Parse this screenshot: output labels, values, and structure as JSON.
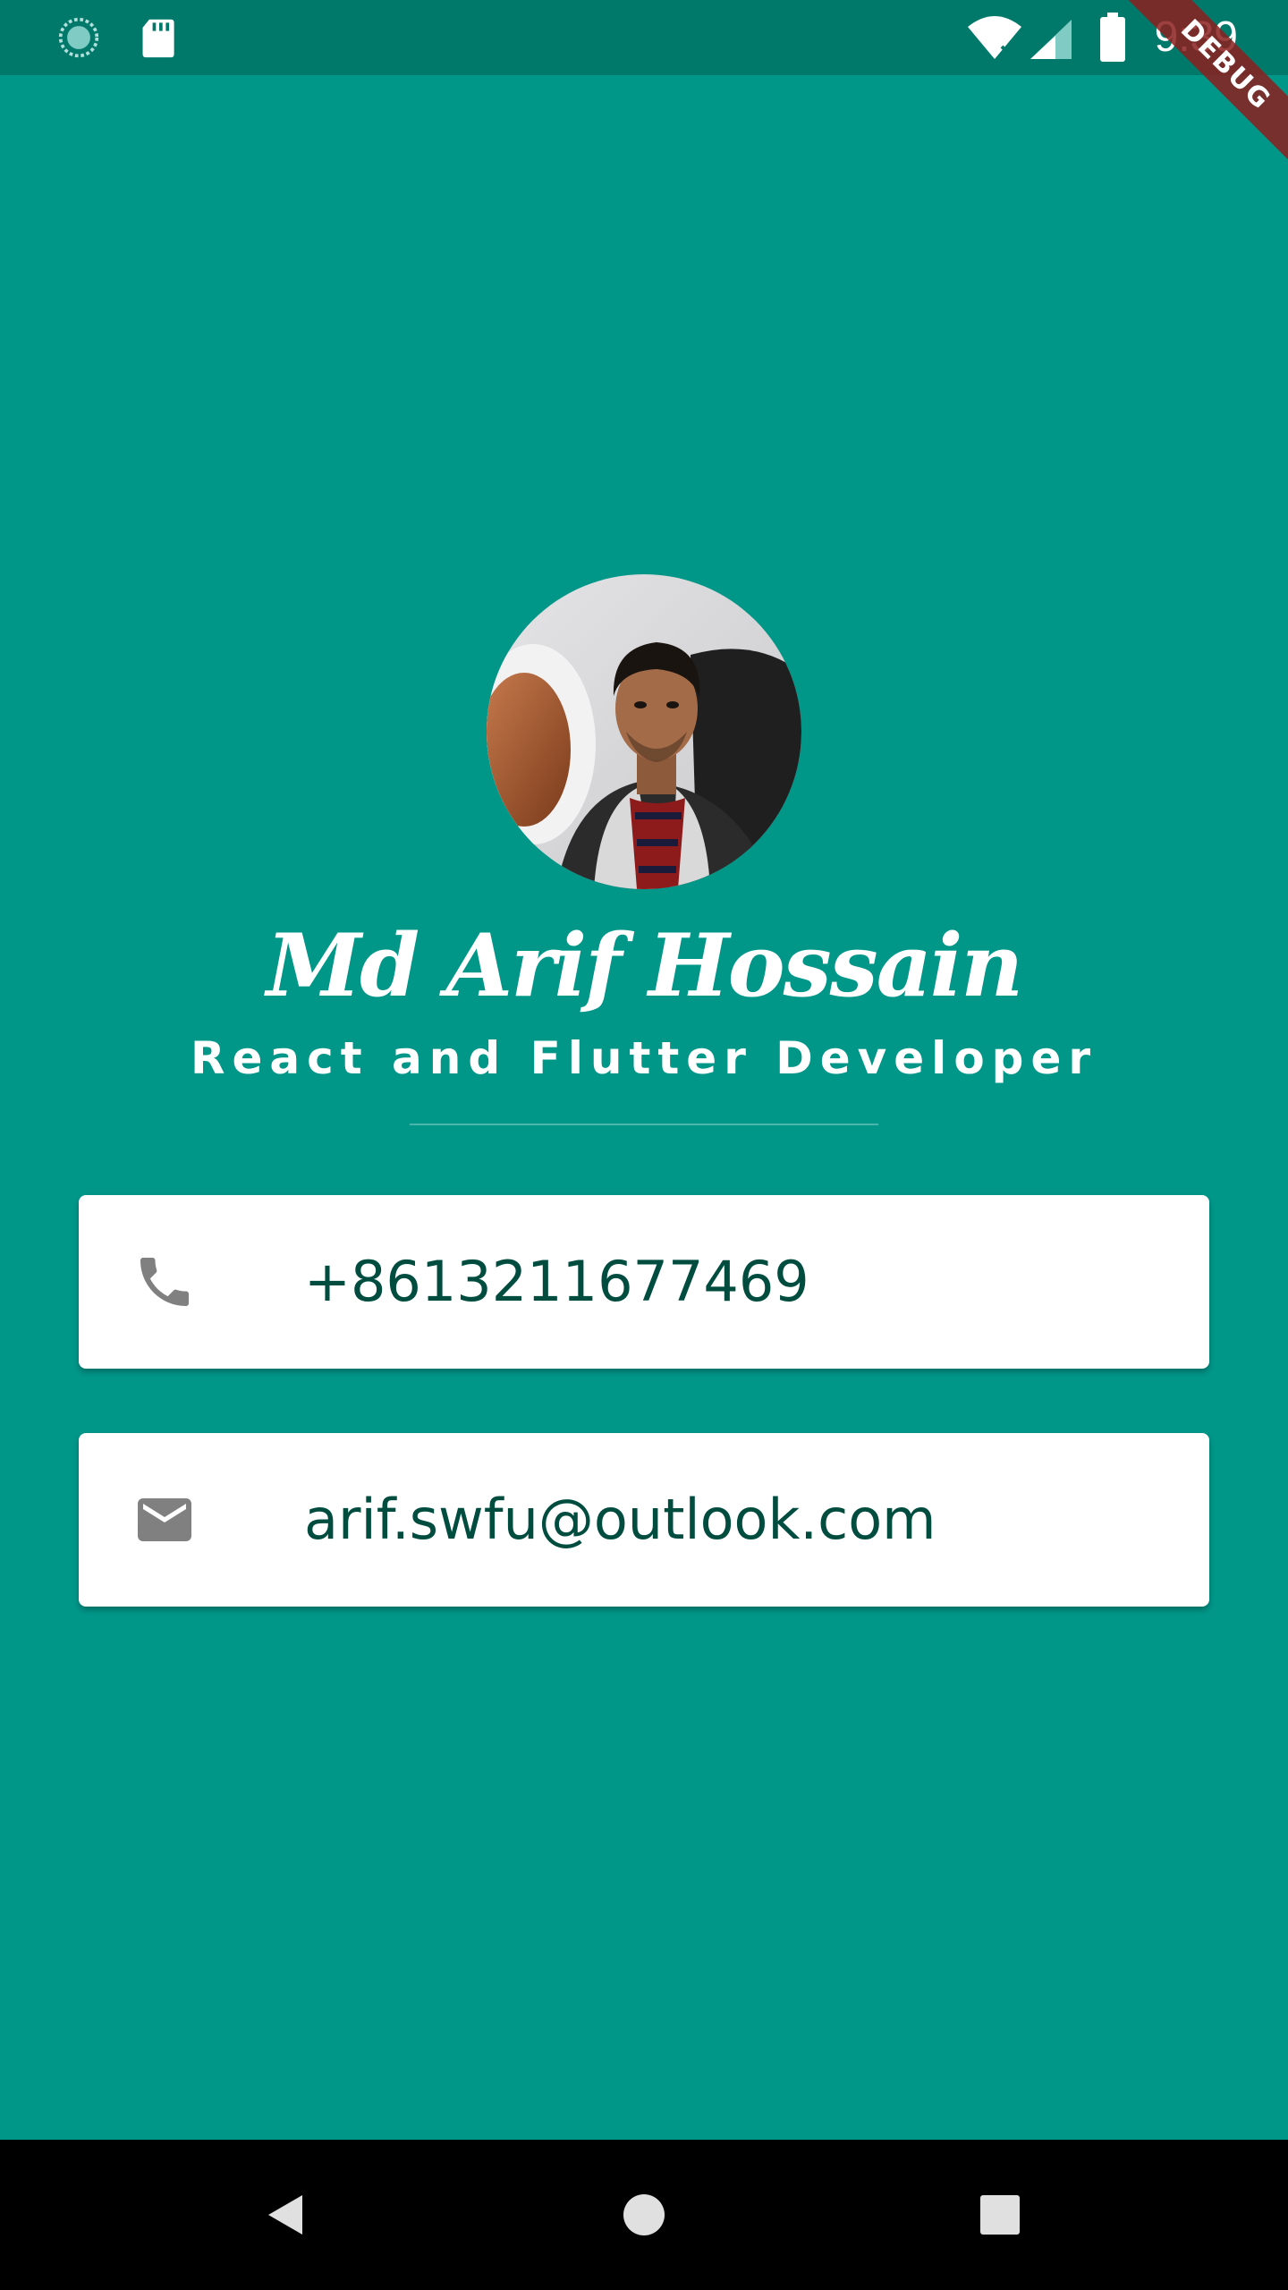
{
  "status_bar": {
    "time": "9:39",
    "left_icons": [
      "sync-icon",
      "sd-card-icon"
    ],
    "right_icons": [
      "wifi-icon",
      "cell-signal-icon",
      "battery-icon"
    ]
  },
  "debug_banner": {
    "label": "DEBUG"
  },
  "profile": {
    "name": "Md Arif Hossain",
    "title": "React and Flutter Developer",
    "avatar": "profile-photo"
  },
  "contacts": {
    "phone": {
      "icon": "phone-icon",
      "value": "+8613211677469"
    },
    "email": {
      "icon": "email-icon",
      "value": "arif.swfu@outlook.com"
    }
  },
  "nav_bar": {
    "buttons": [
      "back-icon",
      "home-icon",
      "recents-icon"
    ]
  },
  "colors": {
    "background": "#009688",
    "status_bar": "#00796b",
    "card": "#ffffff",
    "card_text": "#004d40",
    "icon": "#808080",
    "nav_bar": "#000000"
  }
}
